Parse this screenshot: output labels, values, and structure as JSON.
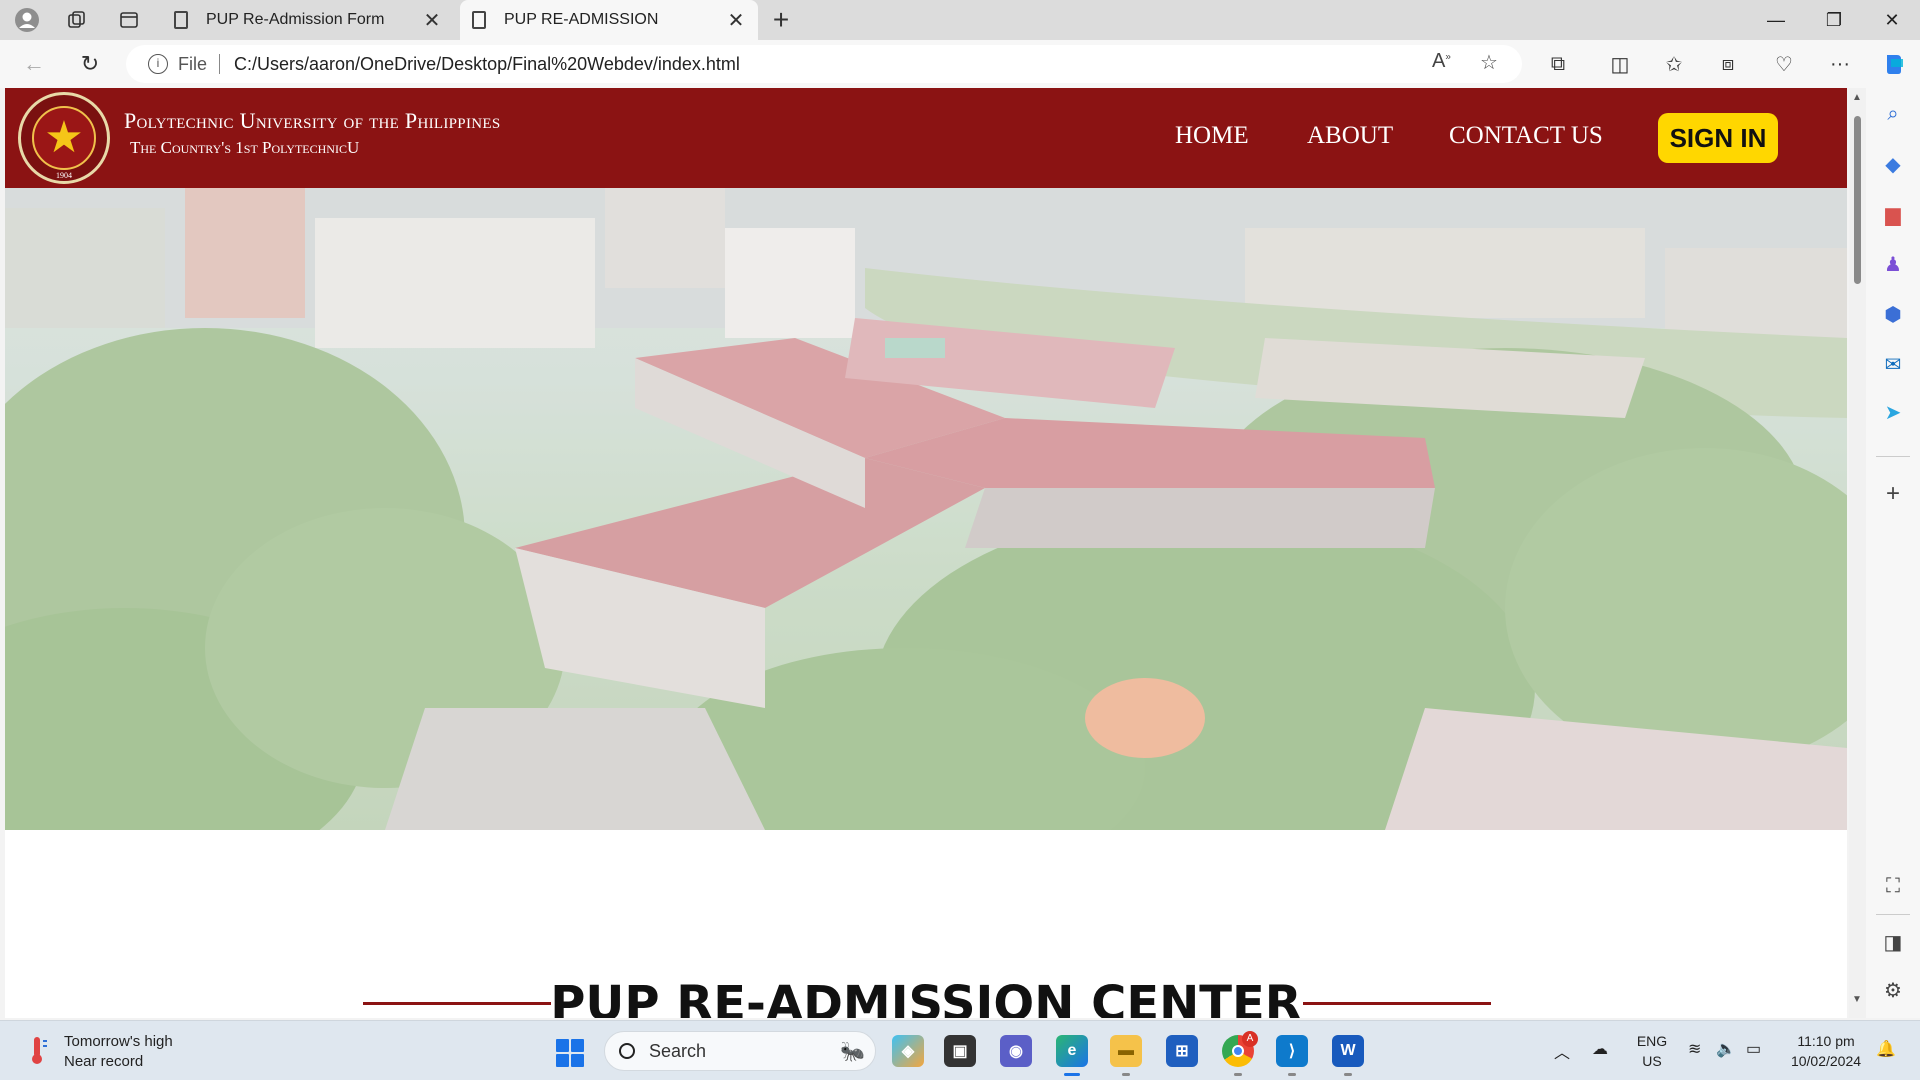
{
  "browser": {
    "tabs": [
      {
        "title": "PUP Re-Admission Form",
        "active": false
      },
      {
        "title": "PUP RE-ADMISSION",
        "active": true
      }
    ],
    "address": {
      "scheme_label": "File",
      "url": "C:/Users/aaron/OneDrive/Desktop/Final%20Webdev/index.html"
    }
  },
  "site": {
    "university_name": "Polytechnic University of the Philippines",
    "tagline": "The Country's 1st PolytechnicU",
    "seal_year": "1904",
    "nav": {
      "home": "HOME",
      "about": "ABOUT",
      "contact": "CONTACT US",
      "signin": "SIGN IN"
    },
    "colors": {
      "header": "#8b1313",
      "signin_button": "#ffd700"
    },
    "section_title": "PUP RE-ADMISSION CENTER"
  },
  "taskbar": {
    "weather_line1": "Tomorrow's high",
    "weather_line2": "Near record",
    "search_placeholder": "Search",
    "language_line1": "ENG",
    "language_line2": "US",
    "time": "11:10 pm",
    "date": "10/02/2024",
    "chrome_badge": "A"
  }
}
